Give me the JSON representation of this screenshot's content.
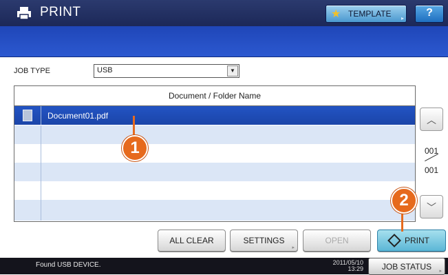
{
  "header": {
    "title": "PRINT",
    "template_label": "TEMPLATE",
    "help_label": "?"
  },
  "job_type": {
    "label": "JOB TYPE",
    "selected": "USB"
  },
  "table": {
    "column_header": "Document / Folder Name",
    "rows": [
      {
        "name": "Document01.pdf",
        "selected": true
      },
      {
        "name": ""
      },
      {
        "name": ""
      },
      {
        "name": ""
      },
      {
        "name": ""
      },
      {
        "name": ""
      }
    ]
  },
  "pagination": {
    "current": "001",
    "total": "001"
  },
  "actions": {
    "all_clear": "ALL CLEAR",
    "settings": "SETTINGS",
    "open": "OPEN",
    "print": "PRINT"
  },
  "callouts": {
    "one": "1",
    "two": "2"
  },
  "status": {
    "message": "Found USB DEVICE.",
    "date": "2011/05/10",
    "time": "13:29",
    "job_status": "JOB STATUS"
  },
  "colors": {
    "title_bar": "#1c2858",
    "band": "#2c59d0",
    "selected_row": "#1b45a9",
    "callout": "#e66a1d"
  },
  "icons": [
    "printer-icon",
    "star-icon",
    "document-icon",
    "chevron-up-icon",
    "chevron-down-icon",
    "start-diamond-icon"
  ]
}
